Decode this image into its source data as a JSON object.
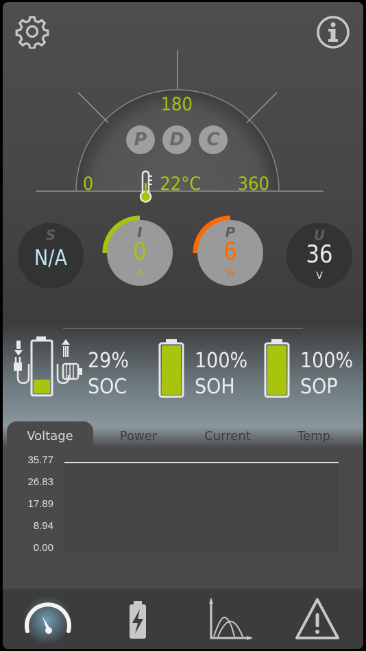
{
  "header": {
    "settings_icon": "gear-icon",
    "info_icon": "info-icon"
  },
  "gauge": {
    "scale_min": "0",
    "scale_mid": "180",
    "scale_max": "360",
    "temperature": "22°C",
    "modes": [
      "P",
      "D",
      "C"
    ],
    "accent_color": "#a8c40c"
  },
  "meters": {
    "s": {
      "letter": "S",
      "value": "N/A",
      "unit": ""
    },
    "i": {
      "letter": "I",
      "value": "0",
      "unit": "A",
      "color": "#a8c40c"
    },
    "p": {
      "letter": "P",
      "value": "6",
      "unit": "W",
      "color": "#ff6a00"
    },
    "u": {
      "letter": "U",
      "value": "36",
      "unit": "V"
    }
  },
  "battery": {
    "soc": {
      "value": "29%",
      "label": "SOC",
      "level": 0.29
    },
    "soh": {
      "value": "100%",
      "label": "SOH",
      "level": 1.0
    },
    "sop": {
      "value": "100%",
      "label": "SOP",
      "level": 1.0
    }
  },
  "tabs": [
    "Voltage",
    "Power",
    "Current",
    "Temp."
  ],
  "chart_data": {
    "type": "line",
    "title": "",
    "xlabel": "",
    "ylabel": "",
    "yticks": [
      "35.77",
      "26.83",
      "17.89",
      "8.94",
      "0.00"
    ],
    "ylim": [
      0,
      35.77
    ],
    "series": [
      {
        "values": [
          35.77,
          35.77
        ]
      }
    ]
  },
  "bottom_nav": [
    "dashboard-icon",
    "battery-icon",
    "chart-icon",
    "warning-icon"
  ]
}
